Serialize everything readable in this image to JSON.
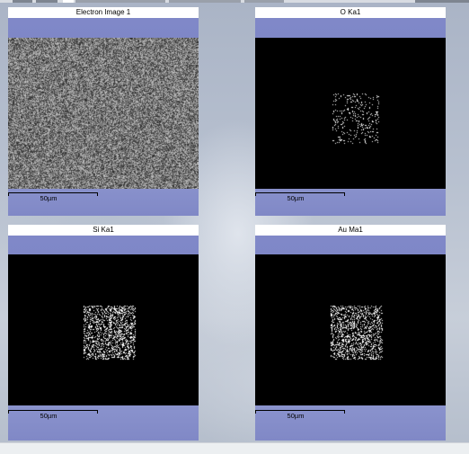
{
  "panels": [
    {
      "title": "Electron Image 1",
      "scale_label": "50µm"
    },
    {
      "title": "O Ka1",
      "scale_label": "50µm"
    },
    {
      "title": "Si Ka1",
      "scale_label": "50µm"
    },
    {
      "title": "Au Ma1",
      "scale_label": "50µm"
    }
  ],
  "colors": {
    "panel_frame": "#8088c8",
    "image_background": "#000000",
    "title_background": "#ffffff"
  }
}
